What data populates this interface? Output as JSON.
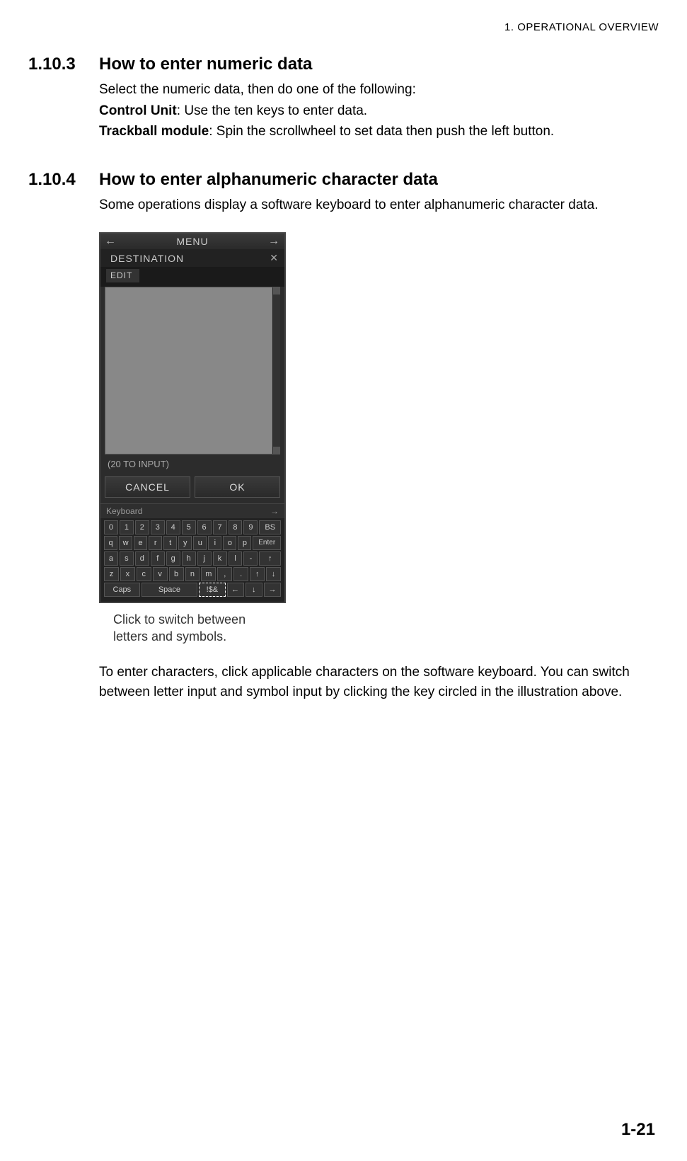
{
  "header": {
    "running": "1.  OPERATIONAL OVERVIEW"
  },
  "sec1": {
    "num": "1.10.3",
    "title": "How to enter numeric data",
    "intro": "Select the numeric data, then do one of the following:",
    "line1_label": "Control Unit",
    "line1_rest": ": Use the ten keys to enter data.",
    "line2_label": "Trackball module",
    "line2_rest": ": Spin the scrollwheel to set data then push the left button."
  },
  "sec2": {
    "num": "1.10.4",
    "title": "How to enter alphanumeric character data",
    "intro": "Some operations display a software keyboard to enter alphanumeric character data.",
    "after": "To enter characters, click applicable characters on the software keyboard. You can switch between letter input and symbol input by clicking the key circled in the illustration above."
  },
  "ui": {
    "menu": "MENU",
    "destination": "DESTINATION",
    "edit": "EDIT",
    "status": "(20 TO INPUT)",
    "cancel": "CANCEL",
    "ok": "OK",
    "kb_label": "Keyboard",
    "row0": [
      "0",
      "1",
      "2",
      "3",
      "4",
      "5",
      "6",
      "7",
      "8",
      "9"
    ],
    "bs": "BS",
    "row1": [
      "q",
      "w",
      "e",
      "r",
      "t",
      "y",
      "u",
      "i",
      "o",
      "p"
    ],
    "enter": "Enter",
    "row2": [
      "a",
      "s",
      "d",
      "f",
      "g",
      "h",
      "j",
      "k",
      "l",
      "-"
    ],
    "row3": [
      "z",
      "x",
      "c",
      "v",
      "b",
      "n",
      "m",
      ",",
      "."
    ],
    "caps": "Caps",
    "space": "Space",
    "sym": "!$&",
    "left": "←",
    "down": "↓",
    "up": "↑",
    "right": "→"
  },
  "callout": {
    "l1": "Click to switch between",
    "l2": "letters and symbols."
  },
  "footer": {
    "page": "1-21"
  }
}
